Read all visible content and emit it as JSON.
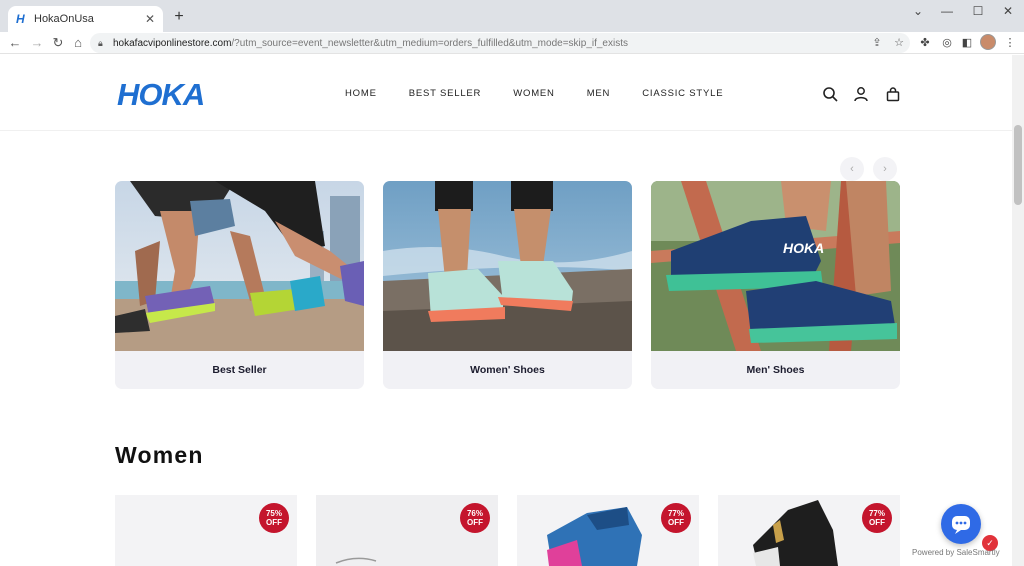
{
  "browser": {
    "tab_title": "HokaOnUsa",
    "tab_close": "✕",
    "new_tab": "+",
    "url_host": "hokafacviponlinestore.com",
    "url_path": "/?utm_source=event_newsletter&utm_medium=orders_fulfilled&utm_mode=skip_if_exists"
  },
  "site": {
    "logo_text": "HOKA",
    "nav": [
      "HOME",
      "BEST SELLER",
      "WOMEN",
      "MEN",
      "CIASSIC STYLE"
    ]
  },
  "categories": [
    {
      "label": "Best Seller"
    },
    {
      "label": "Women' Shoes"
    },
    {
      "label": "Men' Shoes"
    }
  ],
  "carousel": {
    "prev": "‹",
    "next": "›"
  },
  "section": {
    "title": "Women"
  },
  "products": [
    {
      "discount_pct": "75%",
      "off": "OFF"
    },
    {
      "discount_pct": "76%",
      "off": "OFF"
    },
    {
      "discount_pct": "77%",
      "off": "OFF"
    },
    {
      "discount_pct": "77%",
      "off": "OFF"
    }
  ],
  "chat": {
    "powered": "Powered by SaleSmartly",
    "badge": "✓"
  },
  "colors": {
    "brand_blue": "#1f6fd1",
    "badge_red": "#c4152d",
    "chat_blue": "#2f6ae6"
  }
}
